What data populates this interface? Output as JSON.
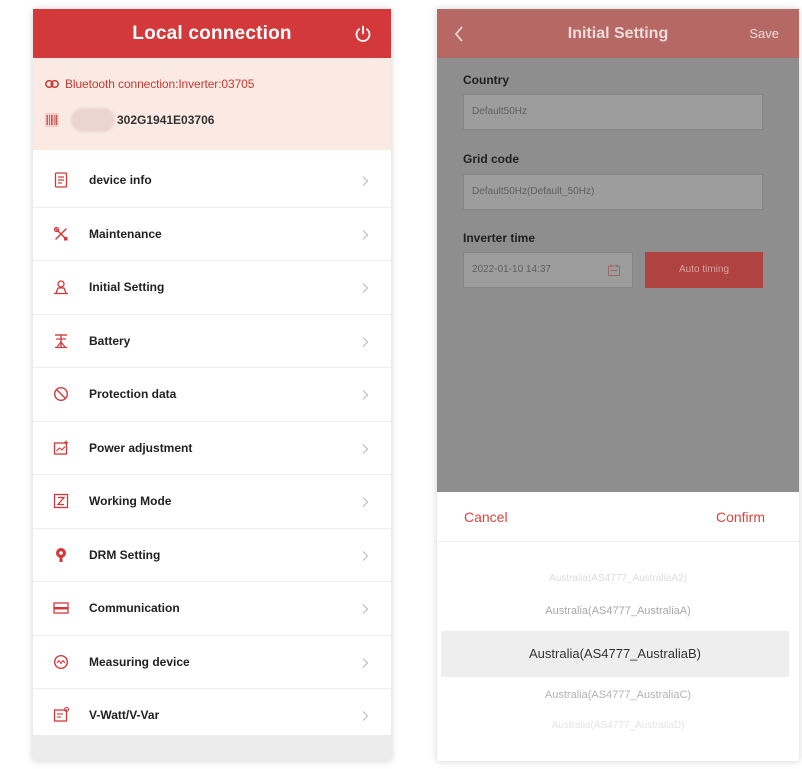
{
  "left": {
    "header": {
      "title": "Local connection"
    },
    "connection": {
      "bluetooth_text": "Bluetooth connection:Inverter:03705",
      "serial_text": "302G1941E03706"
    },
    "menu": {
      "items": [
        {
          "label": "device info",
          "icon": "device-info-icon"
        },
        {
          "label": "Maintenance",
          "icon": "maintenance-icon"
        },
        {
          "label": "Initial Setting",
          "icon": "initial-setting-icon"
        },
        {
          "label": "Battery",
          "icon": "battery-icon"
        },
        {
          "label": "Protection data",
          "icon": "protection-icon"
        },
        {
          "label": "Power adjustment",
          "icon": "power-adjustment-icon"
        },
        {
          "label": "Working Mode",
          "icon": "working-mode-icon"
        },
        {
          "label": "DRM Setting",
          "icon": "drm-setting-icon"
        },
        {
          "label": "Communication",
          "icon": "communication-icon"
        },
        {
          "label": "Measuring device",
          "icon": "measuring-device-icon"
        },
        {
          "label": "V-Watt/V-Var",
          "icon": "v-watt-icon"
        }
      ]
    }
  },
  "right": {
    "header": {
      "title": "Initial Setting",
      "save_label": "Save"
    },
    "form": {
      "country_label": "Country",
      "country_value": "Default50Hz",
      "grid_code_label": "Grid code",
      "grid_code_value": "Default50Hz(Default_50Hz)",
      "inverter_time_label": "Inverter time",
      "inverter_time_value": "2022-01-10 14:37",
      "auto_timing_label": "Auto timing"
    },
    "picker": {
      "cancel_label": "Cancel",
      "confirm_label": "Confirm",
      "options": [
        "Australia(AS4777_AustraliaA2)",
        "Australia(AS4777_AustraliaA)",
        "Australia(AS4777_AustraliaB)",
        "Australia(AS4777_AustraliaC)",
        "Australia(AS4777_AustraliaD)"
      ]
    }
  },
  "colors": {
    "brand_red": "#d3393a",
    "connection_bg": "#fbe9e4",
    "dim_overlay": "#8e8e8e",
    "accent_text": "#d4473f"
  }
}
